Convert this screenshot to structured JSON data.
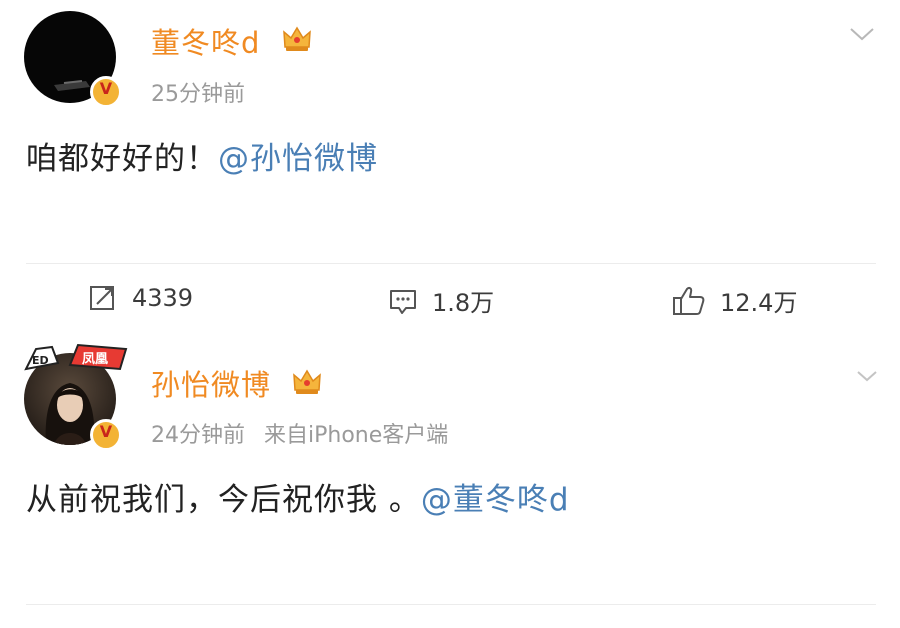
{
  "posts": [
    {
      "author": "董冬咚d",
      "time": "25分钟前",
      "source": "",
      "text": "咱都好好的！",
      "mention": "@孙怡微博",
      "actions": {
        "repost": "4339",
        "comment": "1.8万",
        "like": "12.4万"
      },
      "badge_symbol": "V"
    },
    {
      "author": "孙怡微博",
      "time": "24分钟前",
      "source": "来自iPhone客户端",
      "text": "从前祝我们，今后祝你我 。",
      "mention": "@董冬咚d",
      "badge_symbol": "V",
      "avatar_sticker_text": "凤凰"
    }
  ],
  "colors": {
    "name": "#f08a22",
    "mention": "#4a7fb5",
    "meta": "#9a9a9a",
    "text": "#222222",
    "badge": "#f3b335"
  },
  "icons": [
    "repost-icon",
    "comment-icon",
    "like-icon",
    "chevron-down-icon",
    "crown-icon",
    "verified-badge-icon"
  ]
}
